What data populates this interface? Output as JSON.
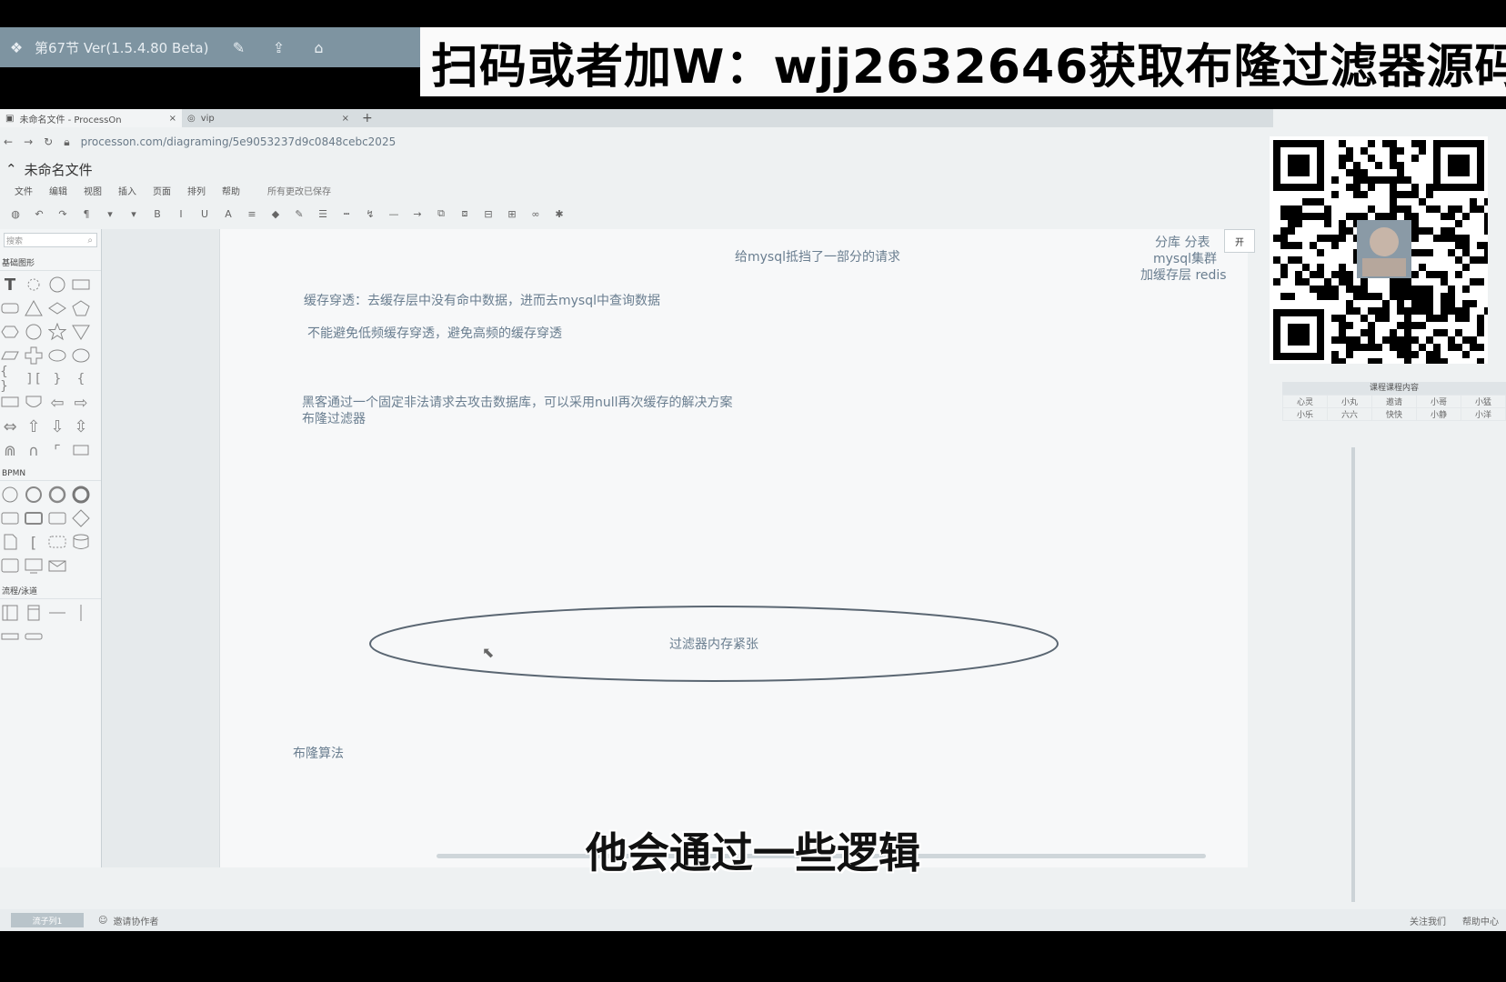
{
  "player": {
    "title": "第67节 Ver(1.5.4.80 Beta)",
    "buttons": [
      "edit-icon",
      "share-icon",
      "home-icon"
    ]
  },
  "promo": "扫码或者加W：wjj2632646获取布隆过滤器源码",
  "browser": {
    "tabs": [
      {
        "label": "未命名文件 - ProcessOn",
        "close": "×"
      },
      {
        "label": "vip",
        "close": "×"
      }
    ],
    "new_tab": "+",
    "url": "processon.com/diagraming/5e9053237d9c0848cebc2025",
    "right_edge_label": "开"
  },
  "app": {
    "doc_title": "未命名文件",
    "menu": [
      "文件",
      "编辑",
      "视图",
      "插入",
      "页面",
      "排列",
      "帮助"
    ],
    "saved_status": "所有更改已保存",
    "search_placeholder": "搜索",
    "sections": [
      "基础图形",
      "BPMN",
      "流程/泳道"
    ]
  },
  "canvas": {
    "top_center": "给mysql抵挡了一部分的请求",
    "top_right_1": "分库  分表",
    "top_right_2": "mysql集群",
    "top_right_3": "加缓存层 redis",
    "line1": "缓存穿透：去缓存层中没有命中数据，进而去mysql中查询数据",
    "line2": "不能避免低频缓存穿透，避免高频的缓存穿透",
    "line3": "黑客通过一个固定非法请求去攻击数据库，可以采用null再次缓存的解决方案",
    "line4": "布隆过滤器",
    "ellipse_label": "过滤器内存紧张",
    "line5": "布隆算法"
  },
  "schedule": {
    "title": "课程课程内容",
    "rows": [
      [
        "心灵",
        "小丸",
        "邀请",
        "小哥",
        "小猛"
      ],
      [
        "小乐",
        "六六",
        "快快",
        "小静",
        "小洋"
      ]
    ]
  },
  "statusbar": {
    "tab": "流子列1",
    "invite": "邀请协作者",
    "right": [
      "关注我们",
      "帮助中心"
    ]
  },
  "subtitle": "他会通过一些逻辑",
  "colors": {
    "canvas_text": "#6a7e90",
    "player_bar": "#7e94a1",
    "promo_bg": "#fafafa"
  }
}
